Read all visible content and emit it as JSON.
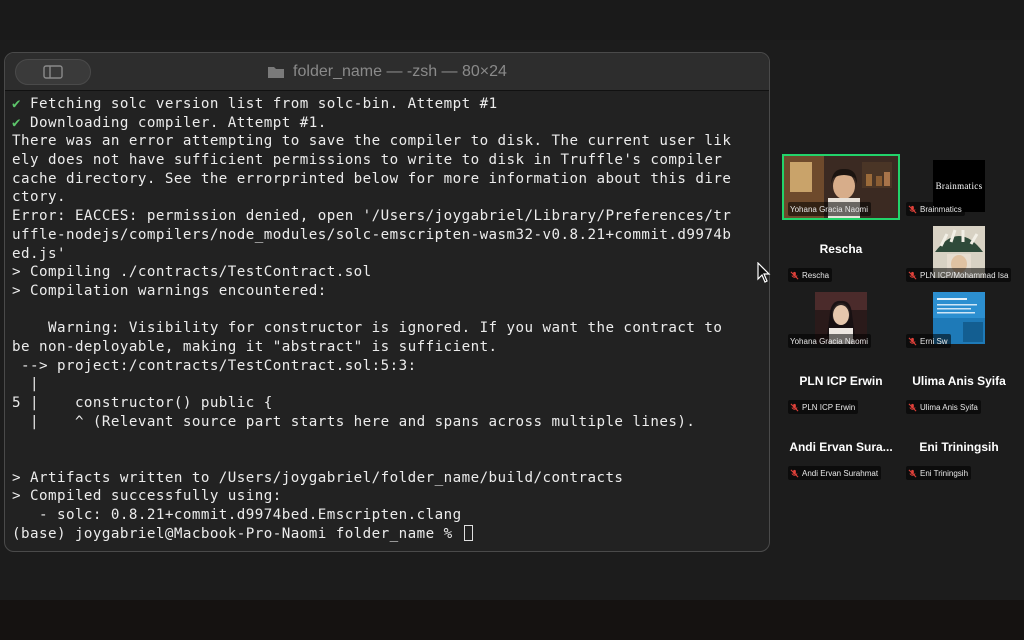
{
  "terminal": {
    "title": "folder_name — -zsh — 80×24",
    "lines": [
      {
        "check": "✔",
        "text": " Fetching solc version list from solc-bin. Attempt #1"
      },
      {
        "check": "✔",
        "text": " Downloading compiler. Attempt #1."
      },
      {
        "check": "",
        "text": "There was an error attempting to save the compiler to disk. The current user lik"
      },
      {
        "check": "",
        "text": "ely does not have sufficient permissions to write to disk in Truffle's compiler"
      },
      {
        "check": "",
        "text": "cache directory. See the errorprinted below for more information about this dire"
      },
      {
        "check": "",
        "text": "ctory."
      },
      {
        "check": "",
        "text": "Error: EACCES: permission denied, open '/Users/joygabriel/Library/Preferences/tr"
      },
      {
        "check": "",
        "text": "uffle-nodejs/compilers/node_modules/solc-emscripten-wasm32-v0.8.21+commit.d9974b"
      },
      {
        "check": "",
        "text": "ed.js'"
      },
      {
        "check": "",
        "text": "> Compiling ./contracts/TestContract.sol"
      },
      {
        "check": "",
        "text": "> Compilation warnings encountered:"
      },
      {
        "check": "",
        "text": ""
      },
      {
        "check": "",
        "text": "    Warning: Visibility for constructor is ignored. If you want the contract to"
      },
      {
        "check": "",
        "text": "be non-deployable, making it \"abstract\" is sufficient."
      },
      {
        "check": "",
        "text": " --> project:/contracts/TestContract.sol:5:3:"
      },
      {
        "check": "",
        "text": "  |"
      },
      {
        "check": "",
        "text": "5 |    constructor() public {"
      },
      {
        "check": "",
        "text": "  |    ^ (Relevant source part starts here and spans across multiple lines)."
      },
      {
        "check": "",
        "text": ""
      },
      {
        "check": "",
        "text": ""
      },
      {
        "check": "",
        "text": "> Artifacts written to /Users/joygabriel/folder_name/build/contracts"
      },
      {
        "check": "",
        "text": "> Compiled successfully using:"
      },
      {
        "check": "",
        "text": "   - solc: 0.8.21+commit.d9974bed.Emscripten.clang"
      }
    ],
    "prompt": "(base) joygabriel@Macbook-Pro-Naomi folder_name % "
  },
  "meeting": {
    "participants": [
      {
        "label": "Yohana Gracia Naomi",
        "big_name": "",
        "video": "camera",
        "active": true,
        "muted": false
      },
      {
        "label": "Brainmatics",
        "big_name": "",
        "video": "logo",
        "logo_text": "Brainmatics",
        "active": false,
        "muted": true
      },
      {
        "label": "Rescha",
        "big_name": "Rescha",
        "video": "none",
        "active": false,
        "muted": true
      },
      {
        "label": "PLN ICP/Mohammad Isa",
        "big_name": "",
        "video": "photo-umbrella",
        "active": false,
        "muted": true
      },
      {
        "label": "Yohana Gracia Naomi",
        "big_name": "",
        "video": "photo-portrait",
        "active": false,
        "muted": false
      },
      {
        "label": "Erni Sw",
        "big_name": "",
        "video": "slide",
        "active": false,
        "muted": true
      },
      {
        "label": "PLN ICP Erwin",
        "big_name": "PLN ICP Erwin",
        "video": "none",
        "active": false,
        "muted": true
      },
      {
        "label": "Ulima Anis Syifa",
        "big_name": "Ulima Anis Syifa",
        "video": "none",
        "active": false,
        "muted": true
      },
      {
        "label": "Andi Ervan Surahmat",
        "big_name": "Andi Ervan Sura...",
        "video": "none",
        "active": false,
        "muted": true
      },
      {
        "label": "Eni Triningsih",
        "big_name": "Eni Triningsih",
        "video": "none",
        "active": false,
        "muted": true
      }
    ]
  },
  "colors": {
    "terminal_bg": "#222222",
    "check_green": "#5dc66b",
    "active_speaker": "#22d36a",
    "muted_red": "#e0413a"
  },
  "icons": [
    "sidebar-toggle-icon",
    "folder-icon",
    "mic-muted-icon",
    "mouse-pointer-icon"
  ]
}
